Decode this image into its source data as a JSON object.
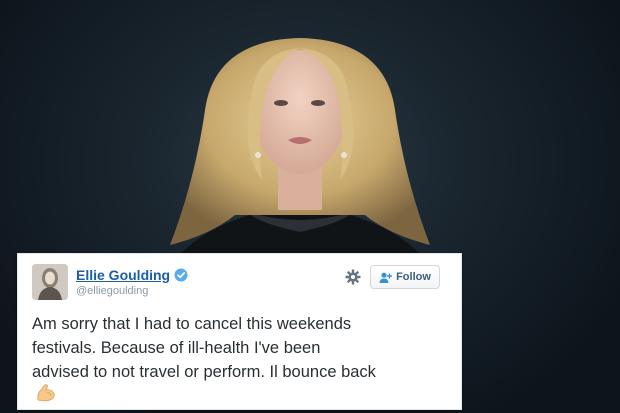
{
  "tweet": {
    "display_name": "Ellie Goulding",
    "handle": "@elliegoulding",
    "follow_label": "Follow",
    "text": "Am sorry that I had to cancel this weekends\nfestivals. Because of ill-health I've been\nadvised to not travel or perform. Il bounce back",
    "icons": {
      "verified": "verified-badge-icon",
      "settings": "gear-icon",
      "follow": "add-user-icon",
      "emoji": "flexed-biceps-emoji-icon"
    }
  },
  "colors": {
    "name_link": "#1b5fa6",
    "verified": "#55acee",
    "tweet_text": "#292f33",
    "handle": "#8899a6",
    "follow_text": "#3b5f80"
  }
}
